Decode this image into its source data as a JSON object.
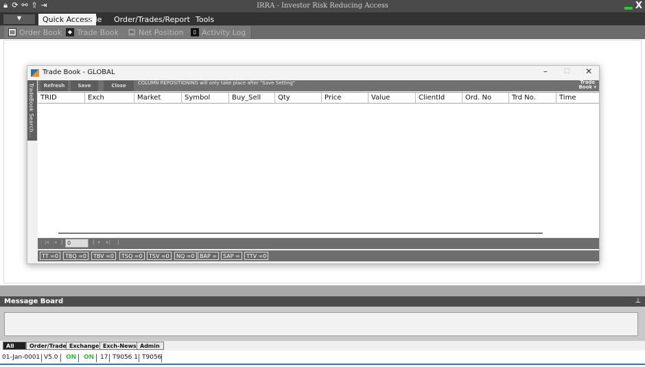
{
  "titlebar": {
    "title": "IRRA - Investor Risk Reducing Access",
    "quick_icons": [
      "lock-icon",
      "refresh-icon",
      "link-icon",
      "upload-icon",
      "logout-icon"
    ],
    "close_label": "X"
  },
  "menubar": {
    "app_button": "▼",
    "items": [
      "Quick Access",
      "File",
      "Order/Trades/Report",
      "Tools"
    ]
  },
  "toolbar": {
    "items": [
      "Order Book",
      "Trade Book",
      "Net Position",
      "Activity Log"
    ]
  },
  "tradebook": {
    "title": "Trade Book - GLOBAL",
    "side_tab": "TradeBook Search...",
    "buttons": [
      "Refresh",
      "Save",
      "Close"
    ],
    "note": "COLUMN REPOSITIONING will only take place after \"Save Setting\"",
    "tradebook_dropdown_line1": "Trade",
    "tradebook_dropdown_line2": "Book ▾",
    "columns": [
      "TRID",
      "Exch",
      "Market",
      "Symbol",
      "Buy_Sell",
      "Qty",
      "Price",
      "Value",
      "ClientId",
      "Ord. No",
      "Trd No.",
      "Time"
    ],
    "pager_value": "0",
    "summary": [
      "TT =0",
      "TBQ =0",
      "TBV =0",
      "TSQ =0",
      "TSV =0",
      "NQ =0",
      "BAP =",
      "SAP =",
      "TTV =0"
    ]
  },
  "message_board": {
    "title": "Message Board",
    "pin": "⊥",
    "tabs": [
      "All",
      "Order/Trade",
      "Exchange",
      "Exch-News",
      "Admin"
    ]
  },
  "statusbar": {
    "date": "01-Jan-0001",
    "version": "V5.0",
    "on1": "ON",
    "on2": "ON",
    "count": "17",
    "user1": "T9056 1",
    "user2": "T9056"
  },
  "colors": {
    "titlebar": "#4a4a4a",
    "menubar": "#323232",
    "toolbar": "#6b6b6b",
    "status_on": "#3ab83a",
    "accent": "#1f73d1"
  }
}
